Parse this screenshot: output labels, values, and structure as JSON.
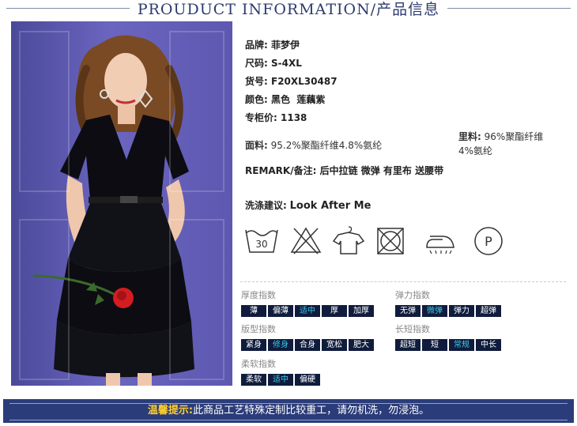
{
  "header": {
    "title": "PROUDUCT INFORMATION/产品信息"
  },
  "specs": [
    {
      "label": "品牌:",
      "value": "菲梦伊"
    },
    {
      "label": "尺码:",
      "value": "S-4XL"
    },
    {
      "label": "货号:",
      "value": "F20XL30487"
    },
    {
      "label": "颜色:",
      "value": "黑色  莲藕紫"
    },
    {
      "label": "专柜价:",
      "value": "1138"
    }
  ],
  "fabric": {
    "label": "面料:",
    "value": "95.2%聚酯纤维4.8%氨纶"
  },
  "lining": {
    "label": "里料:",
    "value": "96%聚酯纤维",
    "value2": "4%氨纶"
  },
  "remark": {
    "label": "REMARK/备注:",
    "value": "后中拉链 微弹 有里布 送腰带"
  },
  "wash": {
    "label": "洗涤建议:",
    "value": "Look After Me"
  },
  "care_icons": [
    "wash-30-icon",
    "no-bleach-icon",
    "hang-dry-icon",
    "no-tumble-dry-icon",
    "iron-icon",
    "dry-clean-p-icon"
  ],
  "care_text": {
    "wash_temp": "30",
    "dry_clean": "P"
  },
  "scales": {
    "thickness": {
      "label": "厚度指数",
      "options": [
        "薄",
        "偏薄",
        "适中",
        "厚",
        "加厚"
      ],
      "selected": 2
    },
    "elasticity": {
      "label": "弹力指数",
      "options": [
        "无弹",
        "微弹",
        "弹力",
        "超弹"
      ],
      "selected": 1
    },
    "fit": {
      "label": "版型指数",
      "options": [
        "紧身",
        "修身",
        "合身",
        "宽松",
        "肥大"
      ],
      "selected": 1
    },
    "length": {
      "label": "长短指数",
      "options": [
        "超短",
        "短",
        "常规",
        "中长"
      ],
      "selected": 2
    },
    "softness": {
      "label": "柔软指数",
      "options": [
        "柔软",
        "适中",
        "偏硬"
      ],
      "selected": 1
    }
  },
  "banner": {
    "warn": "温馨提示:",
    "text": "此商品工艺特殊定制比较重工，请勿机洗，勿浸泡。"
  },
  "colors": {
    "navy": "#2b3c7a",
    "scale_bg": "#0f1c3d",
    "scale_selected": "#3ec7e6",
    "warn": "#ffcf2e"
  }
}
